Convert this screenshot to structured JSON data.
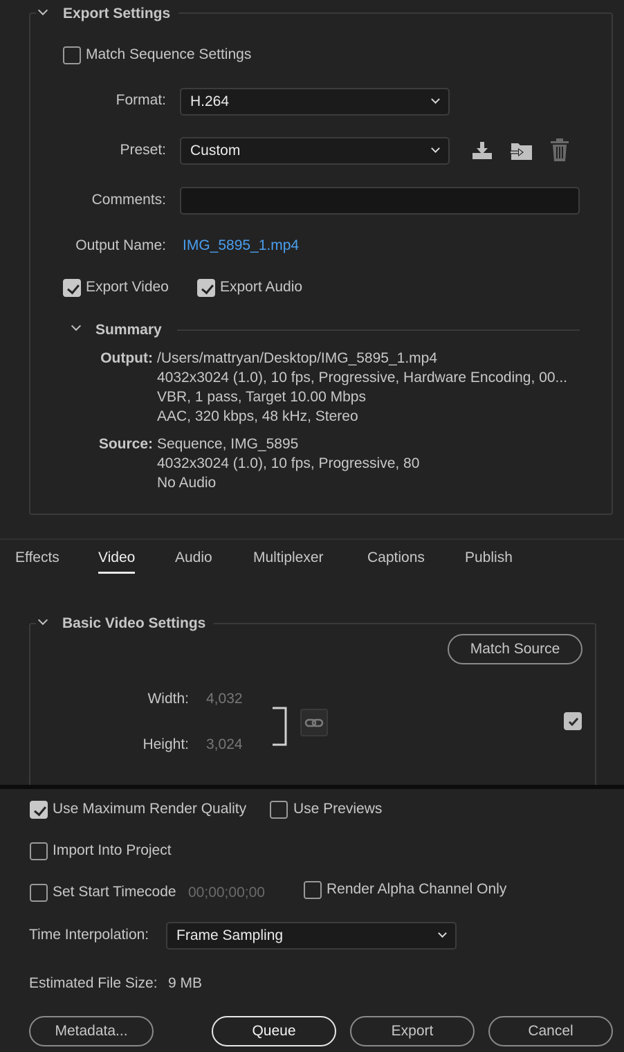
{
  "export_settings": {
    "title": "Export Settings",
    "match_sequence_label": "Match Sequence Settings",
    "match_sequence_checked": false,
    "format_label": "Format:",
    "format_value": "H.264",
    "preset_label": "Preset:",
    "preset_value": "Custom",
    "preset_icons": [
      "save-preset-icon",
      "import-preset-icon",
      "delete-preset-icon"
    ],
    "comments_label": "Comments:",
    "comments_value": "",
    "output_name_label": "Output Name:",
    "output_name_value": "IMG_5895_1.mp4",
    "export_video_label": "Export Video",
    "export_video_checked": true,
    "export_audio_label": "Export Audio",
    "export_audio_checked": true
  },
  "summary": {
    "title": "Summary",
    "output_label": "Output:",
    "output_lines": [
      "/Users/mattryan/Desktop/IMG_5895_1.mp4",
      "4032x3024 (1.0), 10 fps, Progressive, Hardware Encoding, 00...",
      "VBR, 1 pass, Target 10.00 Mbps",
      "AAC, 320 kbps, 48 kHz, Stereo"
    ],
    "source_label": "Source:",
    "source_lines": [
      "Sequence, IMG_5895",
      "4032x3024 (1.0), 10 fps, Progressive, 80",
      "No Audio"
    ]
  },
  "tabs": [
    {
      "label": "Effects",
      "active": false
    },
    {
      "label": "Video",
      "active": true
    },
    {
      "label": "Audio",
      "active": false
    },
    {
      "label": "Multiplexer",
      "active": false
    },
    {
      "label": "Captions",
      "active": false
    },
    {
      "label": "Publish",
      "active": false
    }
  ],
  "basic_video": {
    "title": "Basic Video Settings",
    "match_source_label": "Match Source",
    "width_label": "Width:",
    "width_value": "4,032",
    "height_label": "Height:",
    "height_value": "3,024",
    "link_icon": "link-icon",
    "right_checkbox_checked": true
  },
  "bottom": {
    "max_render_quality_label": "Use Maximum Render Quality",
    "max_render_quality_checked": true,
    "use_previews_label": "Use Previews",
    "use_previews_checked": false,
    "import_into_project_label": "Import Into Project",
    "import_into_project_checked": false,
    "set_start_timecode_label": "Set Start Timecode",
    "set_start_timecode_checked": false,
    "timecode_value": "00;00;00;00",
    "render_alpha_label": "Render Alpha Channel Only",
    "render_alpha_checked": false,
    "time_interpolation_label": "Time Interpolation:",
    "time_interpolation_value": "Frame Sampling",
    "estimated_size_label": "Estimated File Size:",
    "estimated_size_value": "9 MB"
  },
  "buttons": {
    "metadata": "Metadata...",
    "queue": "Queue",
    "export": "Export",
    "cancel": "Cancel"
  },
  "colors": {
    "background": "#232323",
    "link": "#4a9ff0",
    "field_bg": "#1b1b1b"
  }
}
